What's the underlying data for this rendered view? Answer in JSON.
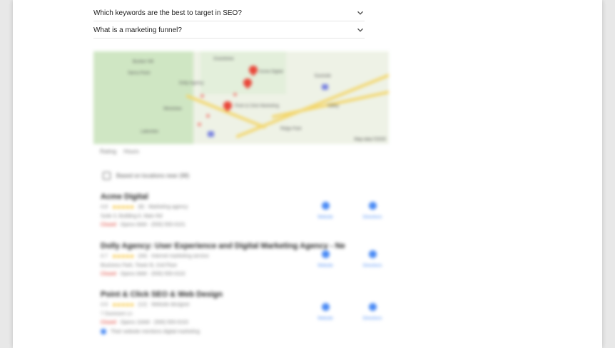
{
  "faq": [
    {
      "question": "Which keywords are the best to target in SEO?"
    },
    {
      "question": "What is a marketing funnel?"
    }
  ],
  "map": {
    "labels": [
      "Bunker Hill",
      "Sierra Point",
      "Grandview",
      "Westview",
      "Eastside",
      "Valley",
      "Lakeview",
      "Ridge Park"
    ],
    "pin_labels": [
      "Acme Digital",
      "Dolly Agency",
      "Point & Click Marketing"
    ],
    "credit": "Map data ©2020"
  },
  "filters": {
    "rating": "Rating",
    "hours": "Hours"
  },
  "hint": {
    "text": "Based on locations near (98)"
  },
  "listings": [
    {
      "name": "Acme Digital",
      "rating": "4.8",
      "reviews": "(8)",
      "category": "Marketing agency",
      "address": "Suite 3, Building 6, Main Rd",
      "status": "Closed",
      "status_detail": "Opens 9AM · (555) 555-0101",
      "website": "Website",
      "directions": "Directions"
    },
    {
      "name": "Dolly Agency: User Experience and Digital Marketing Agency - Ne",
      "rating": "4.7",
      "reviews": "(34)",
      "category": "Internet marketing service",
      "address": "Business Park, Tower B, 2nd Floor",
      "status": "Closed",
      "status_detail": "Opens 9AM · (555) 555-0102",
      "website": "Website",
      "directions": "Directions"
    },
    {
      "name": "Point & Click SEO & Web Design",
      "rating": "4.9",
      "reviews": "(12)",
      "category": "Website designer",
      "address": "7 Dunmore Ln",
      "status": "Closed",
      "status_detail": "Opens 10AM · (555) 555-0103",
      "note": "Their website mentions digital marketing",
      "website": "Website",
      "directions": "Directions"
    }
  ],
  "colors": {
    "accent": "#4a8af4",
    "pin": "#e9473a",
    "stars": "#f4b400",
    "closed": "#d93025"
  }
}
